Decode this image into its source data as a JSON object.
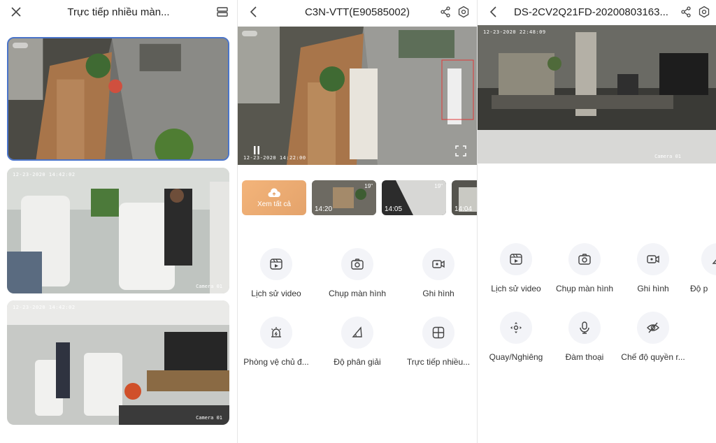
{
  "panel1": {
    "title": "Trực tiếp nhiều màn...",
    "feeds": [
      {
        "timestamp": "",
        "camera": ""
      },
      {
        "timestamp": "12-23-2020 14:42:02",
        "camera": "Camera 01"
      },
      {
        "timestamp": "12-23-2020 14:42:02",
        "camera": "Camera 01"
      }
    ]
  },
  "panel2": {
    "title": "C3N-VTT(E90585002)",
    "feed": {
      "timestamp": "12-23-2020 14:22:00"
    },
    "view_all_label": "Xem tất cả",
    "clips": [
      {
        "time": "14:20",
        "duration": "19\""
      },
      {
        "time": "14:05",
        "duration": "19\""
      },
      {
        "time": "14:04",
        "duration": ""
      }
    ],
    "actions": [
      {
        "label": "Lịch sử video",
        "icon": "video-history-icon"
      },
      {
        "label": "Chụp màn hình",
        "icon": "camera-icon"
      },
      {
        "label": "Ghi hình",
        "icon": "record-icon"
      },
      {
        "label": "Phòng vệ chủ đ...",
        "icon": "alarm-icon"
      },
      {
        "label": "Độ phân giải",
        "icon": "resolution-icon"
      },
      {
        "label": "Trực tiếp nhiều...",
        "icon": "grid-icon"
      }
    ]
  },
  "panel3": {
    "title": "DS-2CV2Q21FD-20200803163...",
    "feed": {
      "timestamp": "12-23-2020 22:48:09",
      "camera": "Camera 01"
    },
    "actions": [
      {
        "label": "Lịch sử video",
        "icon": "video-history-icon"
      },
      {
        "label": "Chụp màn hình",
        "icon": "camera-icon"
      },
      {
        "label": "Ghi hình",
        "icon": "record-icon"
      },
      {
        "label": "Độ p",
        "icon": "resolution-icon"
      },
      {
        "label": "Quay/Nghiêng",
        "icon": "pan-tilt-icon"
      },
      {
        "label": "Đàm thoại",
        "icon": "microphone-icon"
      },
      {
        "label": "Chế độ quyền r...",
        "icon": "privacy-icon"
      }
    ]
  },
  "colors": {
    "accent": "#f2aa6e",
    "icon": "#444444",
    "circle_bg": "#f3f4f8",
    "selected_border": "#4a74c9"
  }
}
